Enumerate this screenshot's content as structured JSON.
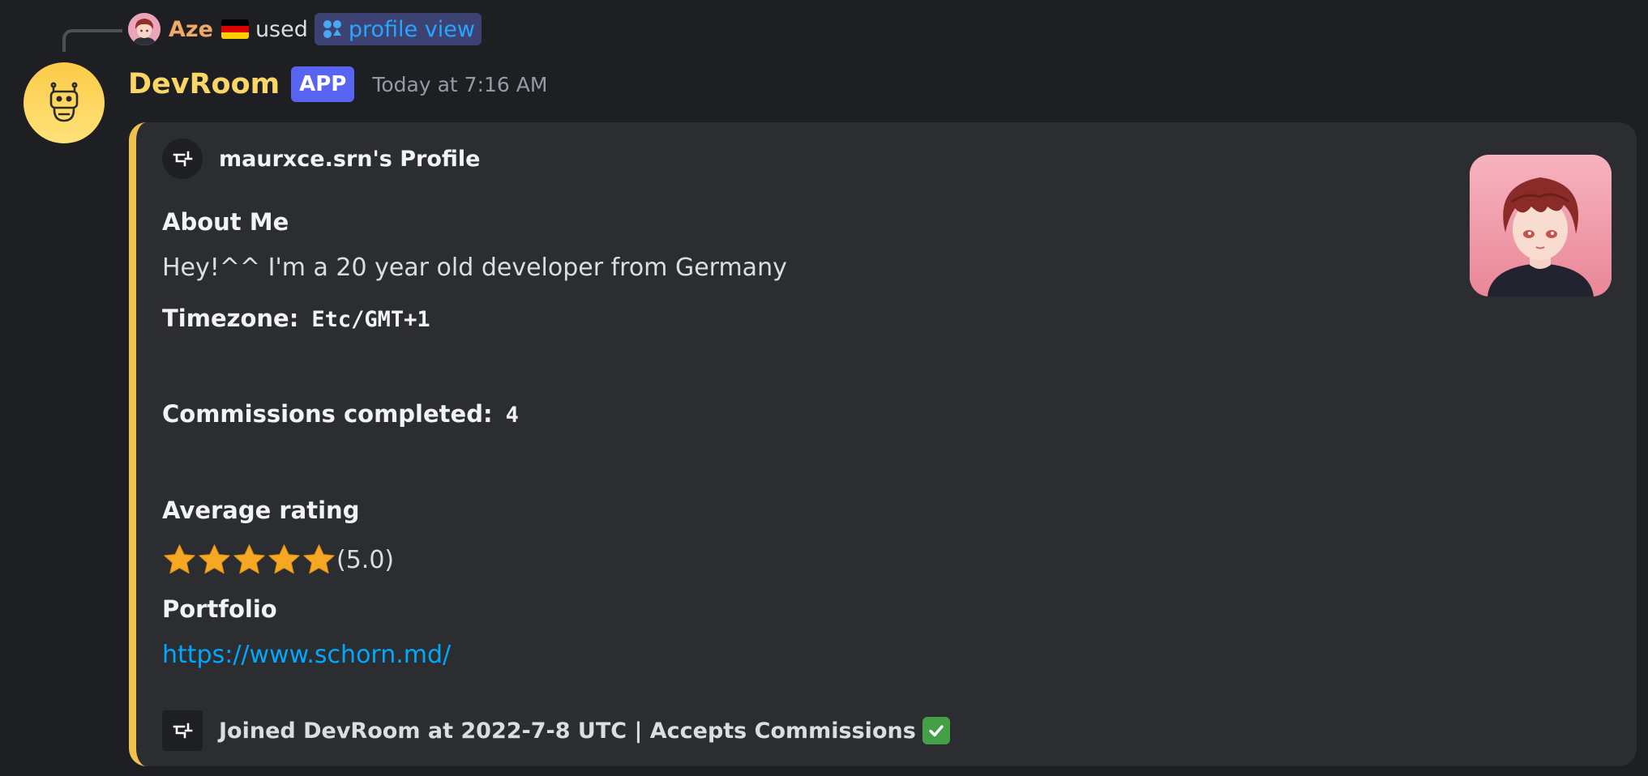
{
  "reply": {
    "user": "Aze",
    "flag_icon": "germany-flag-icon",
    "used_text": "used",
    "command_icon": "command-icon",
    "command_name": "profile view"
  },
  "message": {
    "author": "DevRoom",
    "badge": "APP",
    "timestamp": "Today at 7:16 AM",
    "avatar_icon": "robot-icon"
  },
  "embed": {
    "accent_color": "#f0c24b",
    "author": "maurxce.srn's Profile",
    "about_title": "About Me",
    "about_text": "Hey!^^ I'm a 20 year old developer from Germany",
    "timezone_label": "Timezone:",
    "timezone_value": "Etc/GMT+1",
    "commissions_label": "Commissions completed:",
    "commissions_value": "4",
    "rating_title": "Average rating",
    "rating_stars": 5,
    "rating_max": 5,
    "rating_text": "(5.0)",
    "portfolio_title": "Portfolio",
    "portfolio_link": "https://www.schorn.md/",
    "footer_text": "Joined DevRoom at 2022-7-8 UTC | Accepts Commissions",
    "footer_emoji": "check-mark-button-icon"
  },
  "colors": {
    "background": "#1e1f22",
    "embed_bg": "#2b2d31",
    "bot_name": "#fbd565",
    "reply_user": "#f0a868",
    "link": "#00a8fc",
    "badge": "#5865f2",
    "star": "#f7a823"
  }
}
